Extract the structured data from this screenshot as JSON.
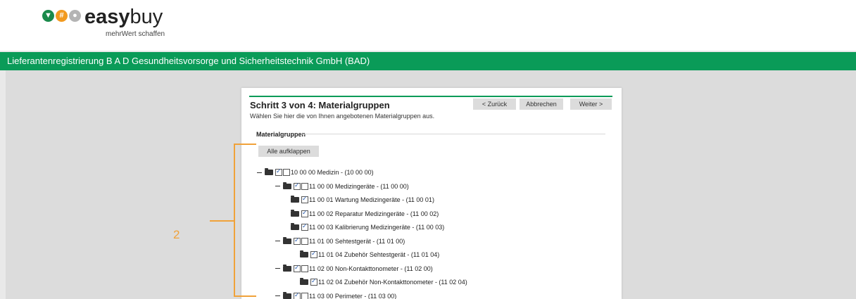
{
  "brand": {
    "name_bold": "easy",
    "name_light": "buy",
    "tagline": "mehrWert schaffen",
    "icons": [
      "shield-logo-icon",
      "warning-logo-icon",
      "gear-logo-icon"
    ],
    "colors": {
      "green": "#1a8a4b",
      "orange": "#f29a1f",
      "grey": "#b4b4b4"
    }
  },
  "header": {
    "title": "Lieferantenregistrierung B A D Gesundheitsvorsorge und Sicherheitstechnik GmbH (BAD)",
    "color": "#0a9b58"
  },
  "wizard": {
    "step_title": "Schritt 3 von 4: Materialgruppen",
    "subtitle": "Wählen Sie hier die von Ihnen angebotenen Materialgruppen aus.",
    "back_label": "< Zurück",
    "cancel_label": "Abbrechen",
    "next_label": "Weiter >",
    "section_label": "Materialgruppen",
    "expand_all_label": "Alle aufklappen"
  },
  "tree": [
    {
      "label": "10 00 00 Medizin - (10 00 00)",
      "collapse": true,
      "checked": true,
      "extra_box": true
    },
    {
      "label": "11 00 00 Medizingeräte - (11 00 00)",
      "collapse": true,
      "checked": true,
      "extra_box": true
    },
    {
      "label": "11 00 01 Wartung Medizingeräte - (11 00 01)",
      "collapse": false,
      "checked": true,
      "extra_box": false
    },
    {
      "label": "11 00 02 Reparatur Medizingeräte - (11 00 02)",
      "collapse": false,
      "checked": true,
      "extra_box": false
    },
    {
      "label": "11 00 03 Kalibrierung Medizingeräte - (11 00 03)",
      "collapse": false,
      "checked": true,
      "extra_box": false
    },
    {
      "label": "11 01 00 Sehtestgerät - (11 01 00)",
      "collapse": true,
      "checked": true,
      "extra_box": true
    },
    {
      "label": "11 01 04 Zubehör Sehtestgerät - (11 01 04)",
      "collapse": false,
      "checked": true,
      "extra_box": false
    },
    {
      "label": "11 02 00 Non-Kontakttonometer - (11 02 00)",
      "collapse": true,
      "checked": true,
      "extra_box": true
    },
    {
      "label": "11 02 04 Zubehör Non-Kontakttonometer - (11 02 04)",
      "collapse": false,
      "checked": true,
      "extra_box": false
    },
    {
      "label": "11 03 00 Perimeter - (11 03 00)",
      "collapse": true,
      "checked": true,
      "extra_box": true
    }
  ],
  "annotation": {
    "number": "2",
    "color": "#f0a23a"
  }
}
